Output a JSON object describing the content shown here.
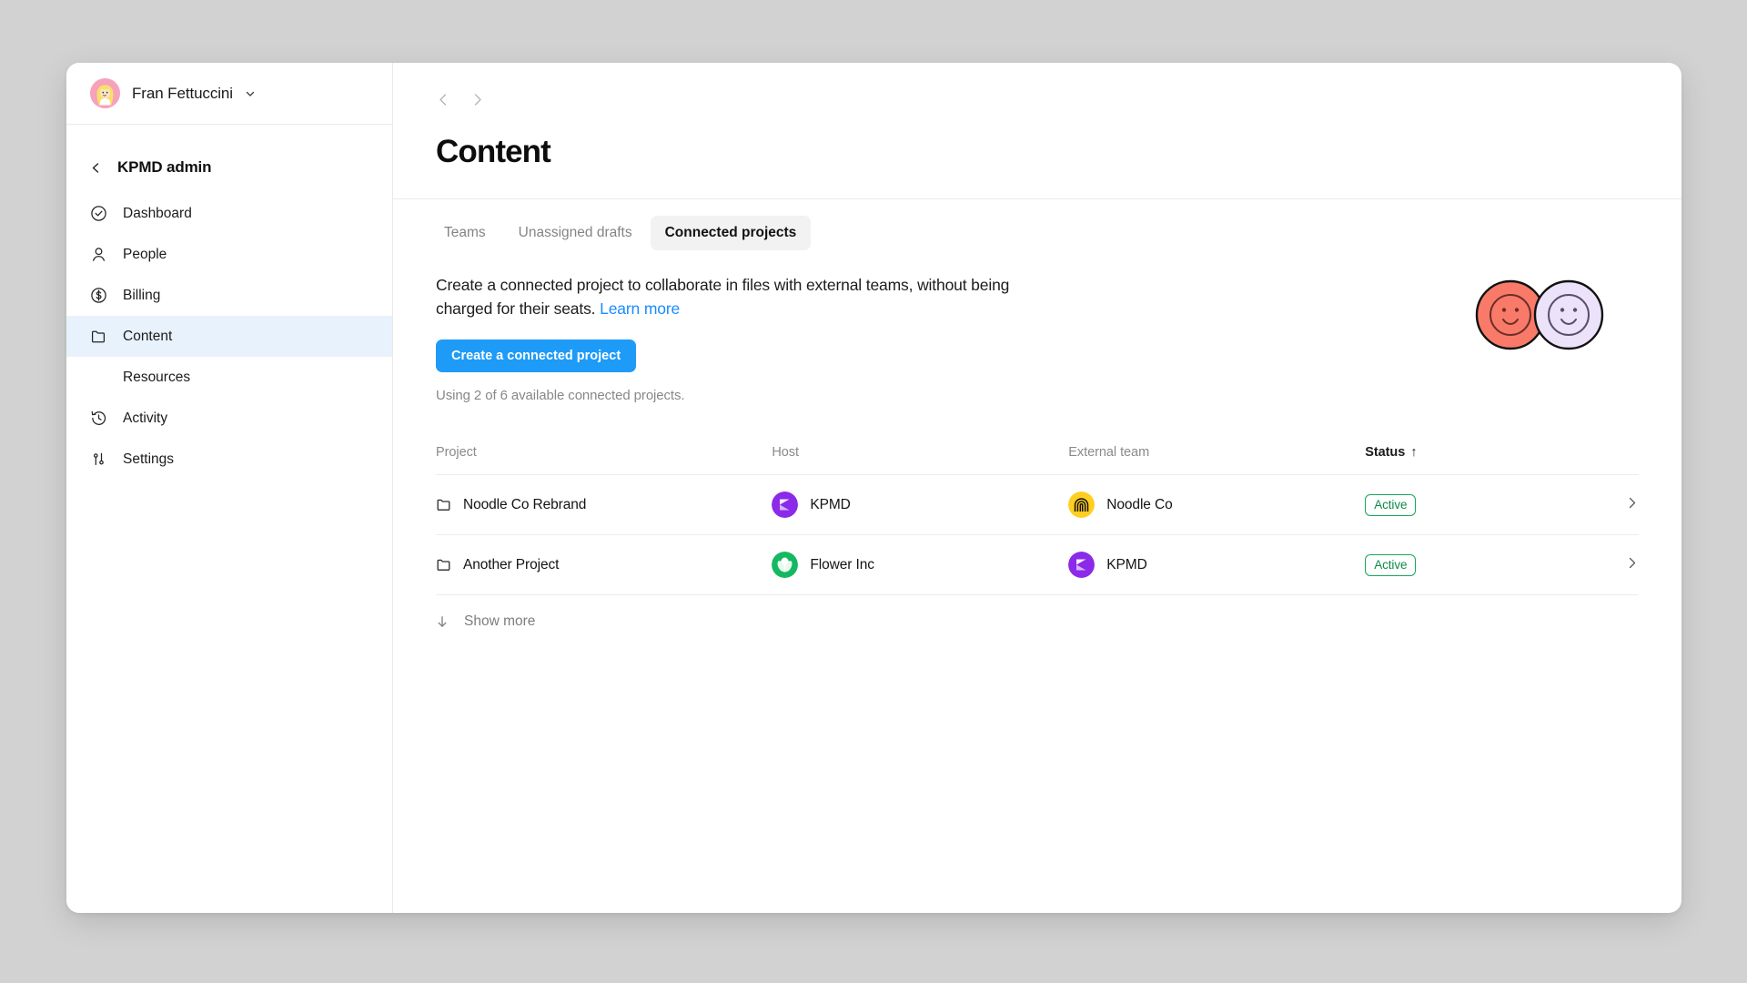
{
  "account": {
    "name": "Fran Fettuccini",
    "chevron_icon": "chevron-down-icon",
    "avatar_icon": "user-avatar"
  },
  "sidebar": {
    "back_label": "KPMD admin",
    "back_icon": "chevron-left-icon",
    "items": [
      {
        "label": "Dashboard",
        "icon": "check-circle-icon",
        "active": false,
        "sub": false
      },
      {
        "label": "People",
        "icon": "person-icon",
        "active": false,
        "sub": false
      },
      {
        "label": "Billing",
        "icon": "dollar-circle-icon",
        "active": false,
        "sub": false
      },
      {
        "label": "Content",
        "icon": "folder-icon",
        "active": true,
        "sub": false
      },
      {
        "label": "Resources",
        "icon": "",
        "active": false,
        "sub": true
      },
      {
        "label": "Activity",
        "icon": "history-icon",
        "active": false,
        "sub": false
      },
      {
        "label": "Settings",
        "icon": "sliders-icon",
        "active": false,
        "sub": false
      }
    ]
  },
  "header": {
    "title": "Content",
    "back_icon": "chevron-left-icon",
    "forward_icon": "chevron-right-icon"
  },
  "tabs": [
    {
      "label": "Teams",
      "active": false
    },
    {
      "label": "Unassigned drafts",
      "active": false
    },
    {
      "label": "Connected projects",
      "active": true
    }
  ],
  "promo": {
    "body_part1": "Create a connected project to collaborate in files with external teams, without being charged for their seats.",
    "link_label": "Learn more",
    "cta_label": "Create a connected project",
    "quota": "Using 2 of 6 available connected projects.",
    "art_icon": "two-smiley-faces-illustration"
  },
  "table": {
    "columns": [
      {
        "label": "Project",
        "sorted": false
      },
      {
        "label": "Host",
        "sorted": false
      },
      {
        "label": "External team",
        "sorted": false
      },
      {
        "label": "Status",
        "sorted": true,
        "sort_indicator": "↑"
      }
    ],
    "rows": [
      {
        "project": "Noodle Co Rebrand",
        "project_icon": "folder-icon",
        "host": "KPMD",
        "host_avatar": "kpmd-logo",
        "external_team": "Noodle Co",
        "external_avatar": "noodle-co-logo",
        "status": "Active",
        "chevron_icon": "chevron-right-icon"
      },
      {
        "project": "Another Project",
        "project_icon": "folder-icon",
        "host": "Flower Inc",
        "host_avatar": "flower-inc-logo",
        "external_team": "KPMD",
        "external_avatar": "kpmd-logo",
        "status": "Active",
        "chevron_icon": "chevron-right-icon"
      }
    ],
    "show_more_label": "Show more",
    "show_more_icon": "arrow-down-icon"
  },
  "colors": {
    "accent_blue": "#1e9bf7",
    "link_blue": "#1a8cff",
    "active_nav_bg": "#e8f2fd",
    "status_green": "#17a65a",
    "kpmd_purple": "#8b2ae8",
    "noodle_yellow": "#ffce21",
    "flower_green": "#15b862",
    "smiley_coral": "#fa7a6a",
    "smiley_lavender": "#ece3fa",
    "page_bg": "#d2d2d2"
  }
}
